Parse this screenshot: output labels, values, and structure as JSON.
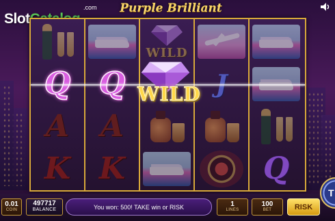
{
  "logo": {
    "slot": "Slot",
    "catalog": "Catalog",
    "com": ".com"
  },
  "game": {
    "title": "Purple Brilliant"
  },
  "reels": {
    "wild_label": "WILD",
    "big_wild_label": "WILD",
    "symbols": {
      "r1": [
        "champagne",
        "Q",
        "A",
        "K"
      ],
      "r2": [
        "yacht",
        "Q",
        "A",
        "K"
      ],
      "r3": [
        "wild-diamond",
        "wild-diamond-big",
        "perfume",
        "yacht"
      ],
      "r4": [
        "plane",
        "J",
        "perfume",
        "jewel"
      ],
      "r5": [
        "yacht",
        "yacht",
        "champagne",
        "Q"
      ]
    },
    "letters": {
      "r1_q": "Q",
      "r1_a": "A",
      "r1_k": "K",
      "r2_q": "Q",
      "r2_a": "A",
      "r2_k": "K",
      "r4_j": "J",
      "r5_q": "Q"
    }
  },
  "bottom": {
    "coin_value": "0.01",
    "coin_label": "COIN",
    "balance_value": "497717",
    "balance_label": "BALANCE",
    "message": "You won: 500! TAKE win or RISK",
    "lines_value": "1",
    "lines_label": "LINES",
    "bet_value": "100",
    "bet_label": "BET",
    "risk_label": "RISK",
    "take_label": "T"
  },
  "colors": {
    "gold": "#d9a93a",
    "purple": "#4a1e7a",
    "logo_green": "#5ed05a"
  },
  "icons": {
    "speaker": "speaker-icon"
  }
}
